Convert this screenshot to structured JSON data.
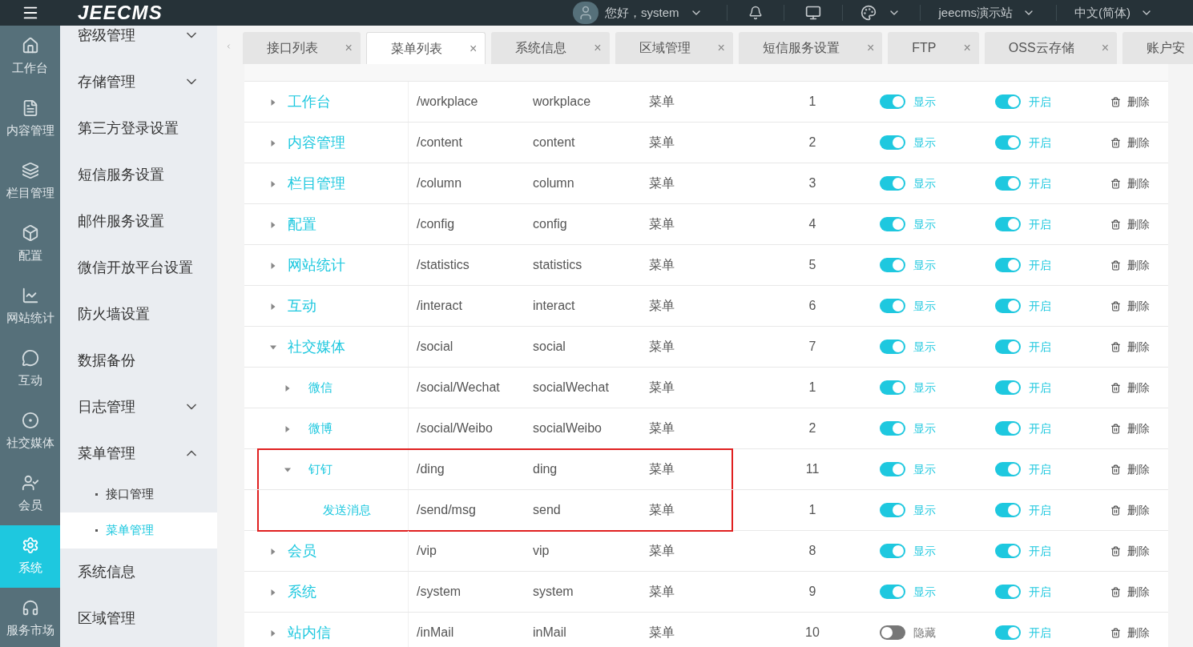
{
  "topbar": {
    "logo": "JEECMS",
    "greeting": "您好，system",
    "site": "jeecms演示站",
    "language": "中文(简体)"
  },
  "rail": [
    {
      "label": "工作台",
      "selected": false
    },
    {
      "label": "内容管理",
      "selected": false
    },
    {
      "label": "栏目管理",
      "selected": false
    },
    {
      "label": "配置",
      "selected": false
    },
    {
      "label": "网站统计",
      "selected": false
    },
    {
      "label": "互动",
      "selected": false
    },
    {
      "label": "社交媒体",
      "selected": false
    },
    {
      "label": "会员",
      "selected": false
    },
    {
      "label": "系统",
      "selected": true
    },
    {
      "label": "服务市场",
      "selected": false
    }
  ],
  "menu": [
    {
      "label": "密级管理",
      "expanded": false
    },
    {
      "label": "存储管理",
      "expanded": false
    },
    {
      "label": "第三方登录设置"
    },
    {
      "label": "短信服务设置"
    },
    {
      "label": "邮件服务设置"
    },
    {
      "label": "微信开放平台设置"
    },
    {
      "label": "防火墙设置"
    },
    {
      "label": "数据备份"
    },
    {
      "label": "日志管理",
      "expanded": false
    },
    {
      "label": "菜单管理",
      "expanded": true,
      "children": [
        {
          "label": "接口管理",
          "selected": false
        },
        {
          "label": "菜单管理",
          "selected": true
        }
      ]
    },
    {
      "label": "系统信息"
    },
    {
      "label": "区域管理"
    }
  ],
  "tabs": [
    {
      "label": "接口列表",
      "selected": false,
      "closable": true
    },
    {
      "label": "菜单列表",
      "selected": true,
      "closable": true
    },
    {
      "label": "系统信息",
      "selected": false,
      "closable": true
    },
    {
      "label": "区域管理",
      "selected": false,
      "closable": true
    },
    {
      "label": "短信服务设置",
      "selected": false,
      "closable": true
    },
    {
      "label": "FTP",
      "selected": false,
      "closable": true
    },
    {
      "label": "OSS云存储",
      "selected": false,
      "closable": true
    },
    {
      "label": "账户安",
      "selected": false,
      "closable": false
    }
  ],
  "tab_close": "×",
  "table": {
    "rows": [
      {
        "name": "工作台",
        "path": "/workplace",
        "perm": "workplace",
        "type": "菜单",
        "sort": "1",
        "shown": true,
        "shown_label": "显示",
        "auth": true,
        "auth_label": "开启",
        "action": "删除",
        "expanded": false,
        "highlighted": false
      },
      {
        "name": "内容管理",
        "path": "/content",
        "perm": "content",
        "type": "菜单",
        "sort": "2",
        "shown": true,
        "shown_label": "显示",
        "auth": true,
        "auth_label": "开启",
        "action": "删除",
        "expanded": false,
        "highlighted": false
      },
      {
        "name": "栏目管理",
        "path": "/column",
        "perm": "column",
        "type": "菜单",
        "sort": "3",
        "shown": true,
        "shown_label": "显示",
        "auth": true,
        "auth_label": "开启",
        "action": "删除",
        "expanded": false,
        "highlighted": false
      },
      {
        "name": "配置",
        "path": "/config",
        "perm": "config",
        "type": "菜单",
        "sort": "4",
        "shown": true,
        "shown_label": "显示",
        "auth": true,
        "auth_label": "开启",
        "action": "删除",
        "expanded": false,
        "highlighted": false
      },
      {
        "name": "网站统计",
        "path": "/statistics",
        "perm": "statistics",
        "type": "菜单",
        "sort": "5",
        "shown": true,
        "shown_label": "显示",
        "auth": true,
        "auth_label": "开启",
        "action": "删除",
        "expanded": false,
        "highlighted": false
      },
      {
        "name": "互动",
        "path": "/interact",
        "perm": "interact",
        "type": "菜单",
        "sort": "6",
        "shown": true,
        "shown_label": "显示",
        "auth": true,
        "auth_label": "开启",
        "action": "删除",
        "expanded": false,
        "highlighted": false
      },
      {
        "name": "社交媒体",
        "path": "/social",
        "perm": "social",
        "type": "菜单",
        "sort": "7",
        "shown": true,
        "shown_label": "显示",
        "auth": true,
        "auth_label": "开启",
        "action": "删除",
        "expanded": true,
        "highlighted": false,
        "children": [
          {
            "name": "微信",
            "path": "/social/Wechat",
            "perm": "socialWechat",
            "type": "菜单",
            "sort": "1",
            "shown": true,
            "shown_label": "显示",
            "auth": true,
            "auth_label": "开启",
            "action": "删除",
            "expanded": false,
            "highlighted": false
          },
          {
            "name": "微博",
            "path": "/social/Weibo",
            "perm": "socialWeibo",
            "type": "菜单",
            "sort": "2",
            "shown": true,
            "shown_label": "显示",
            "auth": true,
            "auth_label": "开启",
            "action": "删除",
            "expanded": false,
            "highlighted": false
          },
          {
            "name": "钉钉",
            "path": "/ding",
            "perm": "ding",
            "type": "菜单",
            "sort": "11",
            "shown": true,
            "shown_label": "显示",
            "auth": true,
            "auth_label": "开启",
            "action": "删除",
            "expanded": true,
            "highlighted": true,
            "children": [
              {
                "name": "发送消息",
                "path": "/send/msg",
                "perm": "send",
                "type": "菜单",
                "sort": "1",
                "shown": true,
                "shown_label": "显示",
                "auth": true,
                "auth_label": "开启",
                "action": "删除",
                "highlighted": true
              }
            ]
          }
        ]
      },
      {
        "name": "会员",
        "path": "/vip",
        "perm": "vip",
        "type": "菜单",
        "sort": "8",
        "shown": true,
        "shown_label": "显示",
        "auth": true,
        "auth_label": "开启",
        "action": "删除",
        "expanded": false,
        "highlighted": false
      },
      {
        "name": "系统",
        "path": "/system",
        "perm": "system",
        "type": "菜单",
        "sort": "9",
        "shown": true,
        "shown_label": "显示",
        "auth": true,
        "auth_label": "开启",
        "action": "删除",
        "expanded": false,
        "highlighted": false
      },
      {
        "name": "站内信",
        "path": "/inMail",
        "perm": "inMail",
        "type": "菜单",
        "sort": "10",
        "shown": false,
        "shown_label": "隐藏",
        "auth": true,
        "auth_label": "开启",
        "action": "删除",
        "expanded": false,
        "highlighted": false
      }
    ]
  }
}
